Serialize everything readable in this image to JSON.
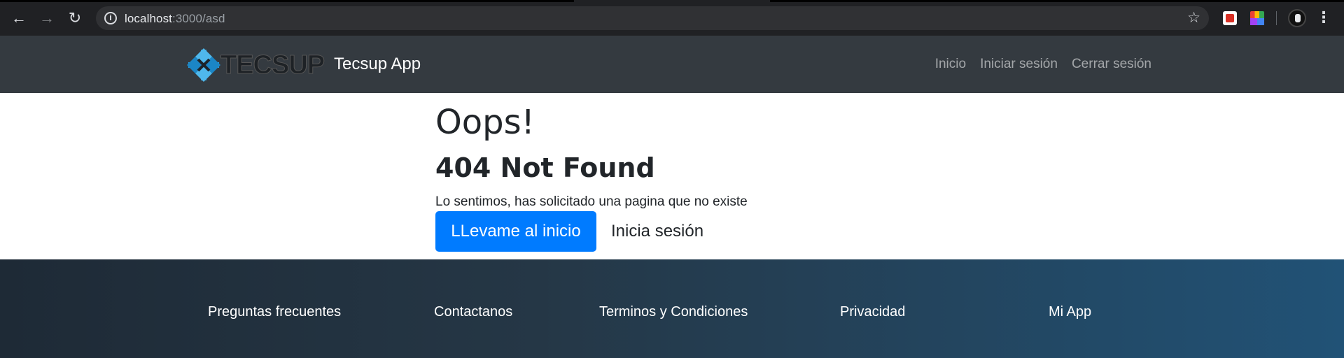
{
  "browser": {
    "url_host": "localhost",
    "url_path": ":3000/asd",
    "icons": [
      "back-icon",
      "forward-icon",
      "reload-icon",
      "info-icon",
      "star-icon"
    ]
  },
  "navbar": {
    "brand": "Tecsup App",
    "logo_text": "TECSUP",
    "links": [
      "Inicio",
      "Iniciar sesión",
      "Cerrar sesión"
    ]
  },
  "main": {
    "title": "Oops!",
    "subtitle": "404 Not Found",
    "message": "Lo sentimos, has solicitado una pagina que no existe",
    "primary_button": "LLevame al inicio",
    "secondary_button": "Inicia sesión"
  },
  "footer": {
    "links": [
      "Preguntas frecuentes",
      "Contactanos",
      "Terminos y Condiciones",
      "Privacidad",
      "Mi App"
    ]
  },
  "colors": {
    "navbar_bg": "#343a40",
    "primary": "#007bff",
    "footer_start": "#1e2a36",
    "footer_end": "#215276"
  }
}
